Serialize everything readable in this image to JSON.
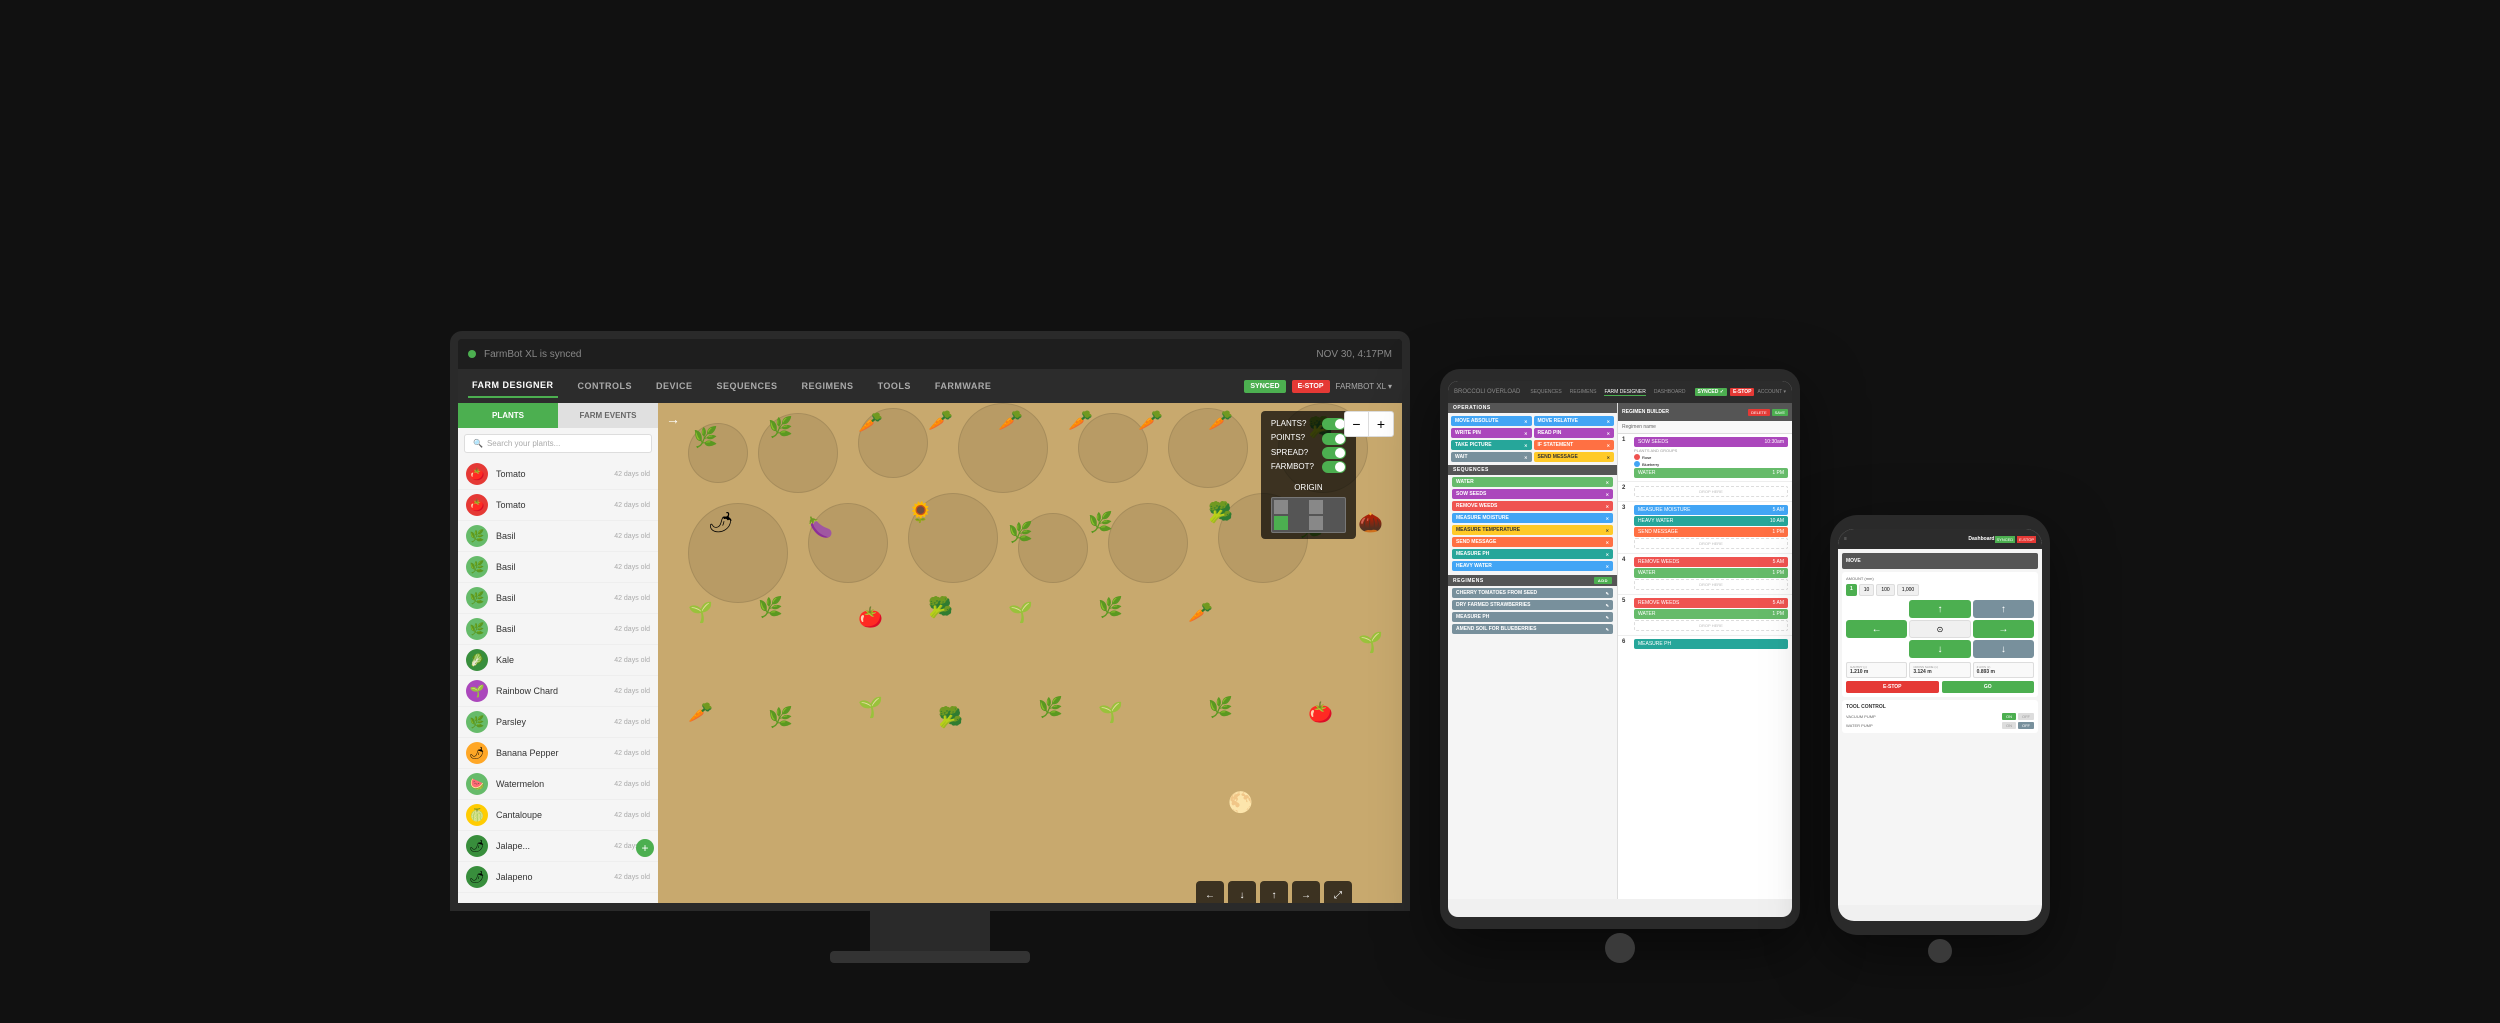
{
  "app": {
    "title": "FarmBot XL is synced",
    "time": "NOV 30, 4:17PM",
    "status": "SYNCED",
    "estop": "E-STOP",
    "farm_name": "FARMBOT XL ▾"
  },
  "nav": {
    "items": [
      {
        "label": "FARM DESIGNER",
        "active": true
      },
      {
        "label": "CONTROLS",
        "active": false
      },
      {
        "label": "DEVICE",
        "active": false
      },
      {
        "label": "SEQUENCES",
        "active": false
      },
      {
        "label": "REGIMENS",
        "active": false
      },
      {
        "label": "TOOLS",
        "active": false
      },
      {
        "label": "FARMWARE",
        "active": false
      }
    ]
  },
  "sidebar": {
    "tabs": [
      "PLANTS",
      "FARM EVENTS"
    ],
    "active_tab": "PLANTS",
    "search_placeholder": "Search your plants...",
    "plants": [
      {
        "name": "Tomato",
        "age": "42 days old",
        "type": "tomato",
        "emoji": "🍅"
      },
      {
        "name": "Tomato",
        "age": "42 days old",
        "type": "tomato",
        "emoji": "🍅"
      },
      {
        "name": "Basil",
        "age": "42 days old",
        "type": "basil",
        "emoji": "🌿"
      },
      {
        "name": "Basil",
        "age": "42 days old",
        "type": "basil",
        "emoji": "🌿"
      },
      {
        "name": "Basil",
        "age": "42 days old",
        "type": "basil",
        "emoji": "🌿"
      },
      {
        "name": "Basil",
        "age": "42 days old",
        "type": "basil",
        "emoji": "🌿"
      },
      {
        "name": "Kale",
        "age": "42 days old",
        "type": "kale",
        "emoji": "🥬"
      },
      {
        "name": "Rainbow Chard",
        "age": "42 days old",
        "type": "chard",
        "emoji": "🌱"
      },
      {
        "name": "Parsley",
        "age": "42 days old",
        "type": "parsley",
        "emoji": "🌿"
      },
      {
        "name": "Banana Pepper",
        "age": "42 days old",
        "type": "pepper",
        "emoji": "🌶"
      },
      {
        "name": "Watermelon",
        "age": "42 days old",
        "type": "watermelon",
        "emoji": "🍉"
      },
      {
        "name": "Cantaloupe",
        "age": "42 days old",
        "type": "cantaloupe",
        "emoji": "🍈"
      },
      {
        "name": "Jalape...",
        "age": "42 days old",
        "type": "jalapeno",
        "emoji": "🌶"
      },
      {
        "name": "Jalapeno",
        "age": "42 days old",
        "type": "jalapeno",
        "emoji": "🌶"
      }
    ]
  },
  "map": {
    "toggle_plants_label": "PLANTS?",
    "toggle_points_label": "POINTS?",
    "toggle_spread_label": "SPREAD?",
    "toggle_farmbot_label": "FARMBOT?",
    "toggle_origin_label": "ORIGIN"
  },
  "tablet": {
    "brand": "BROCCOLI OVERLOAD",
    "nav_items": [
      "SEQUENCES",
      "REGIMENS",
      "FARM DESIGNER",
      "DASHBOARD"
    ],
    "status": "SYNCED",
    "estop": "E-STOP",
    "account": "ACCOUNT ▾",
    "operations_title": "OPERATIONS",
    "regimen_builder_title": "REGIMEN BUILDER",
    "operations": [
      {
        "label": "MOVE ABSOLUTE",
        "color": "blue"
      },
      {
        "label": "MOVE RELATIVE",
        "color": "blue"
      },
      {
        "label": "WRITE PIN",
        "color": "purple"
      },
      {
        "label": "READ PIN",
        "color": "purple"
      },
      {
        "label": "TAKE PICTURE",
        "color": "teal"
      },
      {
        "label": "IF STATEMENT",
        "color": "orange"
      },
      {
        "label": "WAIT",
        "color": "gray"
      },
      {
        "label": "SEND MESSAGE",
        "color": "yellow"
      }
    ],
    "sequences_title": "SEQUENCES",
    "sequences": [
      {
        "label": "WATER",
        "color": "#66bb6a"
      },
      {
        "label": "SOW SEEDS",
        "color": "#ab47bc"
      },
      {
        "label": "REMOVE WEEDS",
        "color": "#ef5350"
      },
      {
        "label": "MEASURE MOISTURE",
        "color": "#42a5f5"
      },
      {
        "label": "MEASURE TEMPERATURE",
        "color": "#ffca28"
      },
      {
        "label": "SEND MESSAGE",
        "color": "#ff7043"
      },
      {
        "label": "MEASURE PH",
        "color": "#26a69a"
      },
      {
        "label": "HEAVY WATER",
        "color": "#42a5f5"
      }
    ],
    "regimens_title": "REGIMENS",
    "regimens_add": "ADD",
    "regimen_sequences": [
      {
        "label": "CHERRY TOMATOES FROM SEED"
      },
      {
        "label": "DRY FARMED STRAWBERRIES"
      },
      {
        "label": "MEASURE PH"
      },
      {
        "label": "AMEND SOIL FOR BLUEBERRIES"
      }
    ],
    "regimen_name_label": "Regimen name",
    "regimen_steps": [
      {
        "num": 1,
        "cards": [
          {
            "label": "SOW SEEDS",
            "color": "purple",
            "detail": "10:30am"
          },
          {
            "label": "WATER",
            "color": "green",
            "detail": "1 PM"
          }
        ],
        "plants_and_groups": true,
        "plants": [
          {
            "name": "Rose",
            "color": "#ef5350"
          },
          {
            "name": "Blueberry",
            "color": "#42a5f5"
          }
        ]
      },
      {
        "num": 2,
        "drop": "DROP HERE"
      },
      {
        "num": 3,
        "cards": [
          {
            "label": "MEASURE MOISTURE",
            "color": "blue",
            "detail": "5 AM"
          },
          {
            "label": "HEAVY WATER",
            "color": "teal",
            "detail": "10 AM"
          },
          {
            "label": "SEND MESSAGE",
            "color": "orange",
            "detail": "1 PM"
          }
        ]
      },
      {
        "num": 4,
        "cards": [
          {
            "label": "REMOVE WEEDS",
            "color": "red",
            "detail": "5 AM"
          },
          {
            "label": "WATER",
            "color": "green",
            "detail": "1 PM"
          }
        ],
        "drop": "DROP HERE"
      },
      {
        "num": 5,
        "cards": [
          {
            "label": "REMOVE WEEDS",
            "color": "red",
            "detail": "5 AM"
          },
          {
            "label": "WATER",
            "color": "green",
            "detail": "1 PM"
          }
        ],
        "drop": "DROP HERE"
      }
    ]
  },
  "phone": {
    "brand": "Dashboard",
    "section_move": "MOVE",
    "amount_label": "AMOUNT (mm)",
    "amounts": [
      1,
      10,
      100,
      1000
    ],
    "active_amount": 1,
    "gantry_label": "GANTRY (y)",
    "gantry_val": "1.210 m",
    "cross_label": "CROSS SLIDE (x)",
    "cross_val": "3.124 m",
    "z_label": "Z AXIS (z)",
    "z_val": "0.893 m",
    "estop_label": "E-STOP",
    "go_label": "GO",
    "tool_control_label": "TOOL CONTROL",
    "vacuum_pump_label": "VACUUM PUMP",
    "vacuum_on": "ON",
    "water_pump_label": "WATER PUMP",
    "water_off": "OFF"
  }
}
